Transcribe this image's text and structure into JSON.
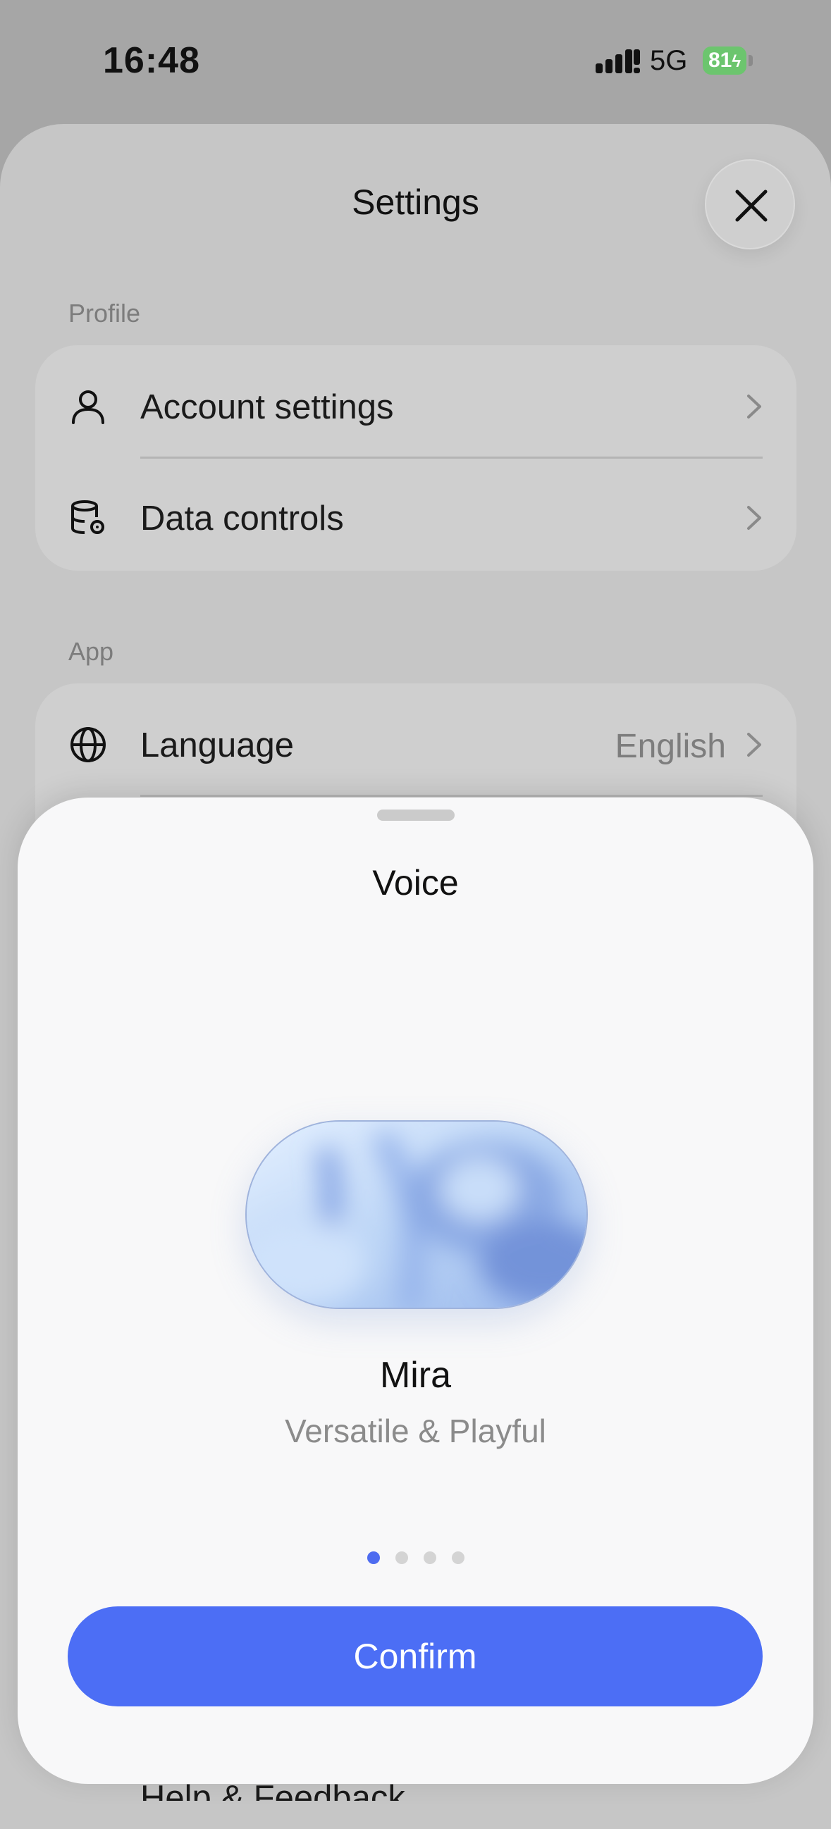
{
  "status_bar": {
    "time": "16:48",
    "network": "5G",
    "battery": "81"
  },
  "settings": {
    "title": "Settings",
    "profile_section": {
      "label": "Profile",
      "items": [
        {
          "label": "Account settings",
          "icon": "person-icon"
        },
        {
          "label": "Data controls",
          "icon": "database-gear-icon"
        }
      ]
    },
    "app_section": {
      "label": "App",
      "items": [
        {
          "label": "Language",
          "value": "English",
          "icon": "globe-icon"
        }
      ]
    },
    "help_label": "Help & Feedback"
  },
  "voice_sheet": {
    "title": "Voice",
    "voice_name": "Mira",
    "voice_description": "Versatile & Playful",
    "page_count": 4,
    "active_page": 1,
    "confirm_label": "Confirm",
    "accent_color": "#4c6ef5"
  }
}
